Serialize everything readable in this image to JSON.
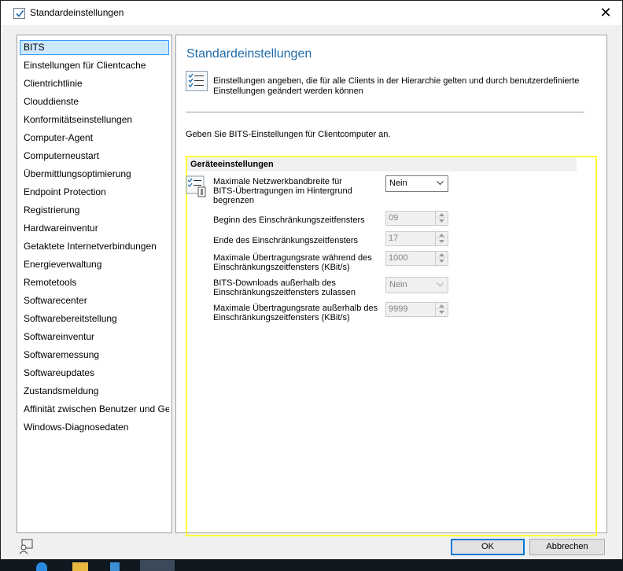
{
  "window": {
    "title": "Standardeinstellungen",
    "close_glyph": "✕"
  },
  "nav": {
    "items": [
      "BITS",
      "Einstellungen für Clientcache",
      "Clientrichtlinie",
      "Clouddienste",
      "Konformitätseinstellungen",
      "Computer-Agent",
      "Computerneustart",
      "Übermittlungsoptimierung",
      "Endpoint Protection",
      "Registrierung",
      "Hardwareinventur",
      "Getaktete Internetverbindungen",
      "Energieverwaltung",
      "Remotetools",
      "Softwarecenter",
      "Softwarebereitstellung",
      "Softwareinventur",
      "Softwaremessung",
      "Softwareupdates",
      "Zustandsmeldung",
      "Affinität zwischen Benutzer und Ge",
      "Windows-Diagnosedaten"
    ],
    "selected_index": 0
  },
  "content": {
    "title": "Standardeinstellungen",
    "description_line1": "Einstellungen angeben, die für alle Clients in der Hierarchie gelten und durch benutzerdefinierte",
    "description_line2": "Einstellungen geändert werden können",
    "intro": "Geben Sie BITS-Einstellungen für Clientcomputer an.",
    "group_header": "Geräteeinstellungen",
    "settings": {
      "limit_bandwidth": {
        "label_line1": "Maximale Netzwerkbandbreite für",
        "label_line2": "BITS-Übertragungen im Hintergrund",
        "label_line3": "begrenzen",
        "value": "Nein"
      },
      "window_start": {
        "label": "Beginn des Einschränkungszeitfensters",
        "value": "09"
      },
      "window_end": {
        "label": "Ende des Einschränkungszeitfensters",
        "value": "17"
      },
      "rate_during": {
        "label_line1": "Maximale Übertragungsrate während des",
        "label_line2": "Einschränkungszeitfensters (KBit/s)",
        "value": "1000"
      },
      "allow_outside": {
        "label_line1": "BITS-Downloads außerhalb des",
        "label_line2": "Einschränkungszeitfensters zulassen",
        "value": "Nein"
      },
      "rate_outside": {
        "label_line1": "Maximale Übertragungsrate außerhalb des",
        "label_line2": "Einschränkungszeitfensters (KBit/s)",
        "value": "9999"
      }
    }
  },
  "buttons": {
    "ok": "OK",
    "cancel": "Abbrechen"
  },
  "colors": {
    "accent": "#0078d7",
    "title_blue": "#1e6aa8",
    "selection": "#cce8ff",
    "highlight": "#ffff3a"
  },
  "icons": [
    "checkbox-icon",
    "close-icon",
    "checklist-icon",
    "settings-checklist-icon",
    "chevron-down-icon",
    "spin-up-icon",
    "spin-down-icon",
    "feedback-icon"
  ]
}
